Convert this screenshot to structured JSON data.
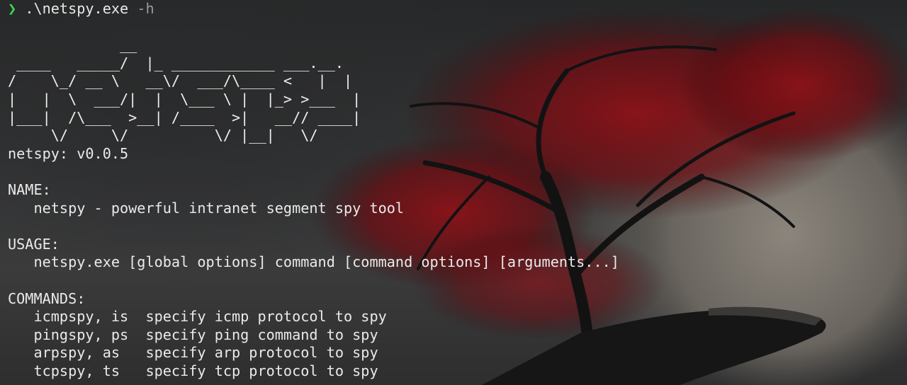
{
  "window": {
    "title": "Terminal"
  },
  "prompt": {
    "symbol": "❯",
    "command": ".\\netspy.exe",
    "flag": "-h"
  },
  "banner": [
    "",
    "             __",
    " ____   _____/  |_ ____________ ___.__.",
    "/    \\_/ __ \\   __\\/  ___/\\____ <   |  |",
    "|   |  \\  ___/|  |  \\___ \\ |  |_> >___  |",
    "|___|  /\\___  >__| /____  >|   __// ____|",
    "     \\/     \\/          \\/ |__|   \\/"
  ],
  "version_line": "netspy: v0.0.5",
  "sections": {
    "name_header": "NAME:",
    "name_text": "   netspy - powerful intranet segment spy tool",
    "usage_header": "USAGE:",
    "usage_text": "   netspy.exe [global options] command [command options] [arguments...]",
    "commands_header": "COMMANDS:"
  },
  "commands": [
    "   icmpspy, is  specify icmp protocol to spy",
    "   pingspy, ps  specify ping command to spy",
    "   arpspy, as   specify arp protocol to spy",
    "   tcpspy, ts   specify tcp protocol to spy"
  ],
  "colors": {
    "prompt_symbol": "#3fd451",
    "text": "#eaeaea",
    "flag": "#9a9a9a",
    "background": "#2b2c2d",
    "tree_foliage": "#7a0f14"
  },
  "icons": {
    "prompt": "chevron-right-icon"
  }
}
